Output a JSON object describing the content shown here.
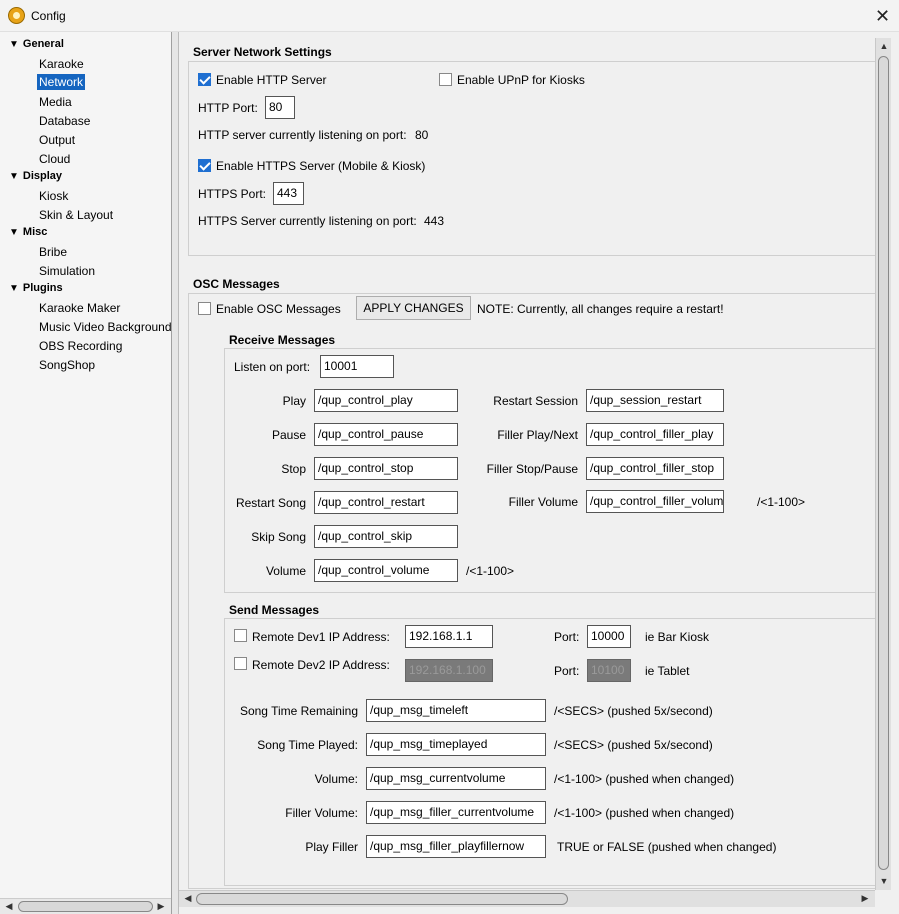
{
  "window": {
    "title": "Config",
    "close": "✕"
  },
  "sidebar": {
    "groups": [
      {
        "label": "General",
        "items": [
          "Karaoke",
          "Network",
          "Media",
          "Database",
          "Output",
          "Cloud"
        ]
      },
      {
        "label": "Display",
        "items": [
          "Kiosk",
          "Skin & Layout"
        ]
      },
      {
        "label": "Misc",
        "items": [
          "Bribe",
          "Simulation"
        ]
      },
      {
        "label": "Plugins",
        "items": [
          "Karaoke Maker",
          "Music Video Background",
          "OBS Recording",
          "SongShop"
        ]
      }
    ],
    "selected": "Network"
  },
  "server": {
    "title": "Server Network Settings",
    "http_enable": "Enable HTTP Server",
    "http_checked": true,
    "upnp_enable": "Enable UPnP for Kiosks",
    "upnp_checked": false,
    "http_port_label": "HTTP Port:",
    "http_port": "80",
    "http_status_label": "HTTP server currently listening on port:",
    "http_status_port": "80",
    "https_enable": "Enable HTTPS Server (Mobile & Kiosk)",
    "https_checked": true,
    "https_port_label": "HTTPS Port:",
    "https_port": "443",
    "https_status_label": "HTTPS Server currently listening on port:",
    "https_status_port": "443"
  },
  "osc": {
    "title": "OSC Messages",
    "enable": "Enable OSC Messages",
    "enabled": false,
    "apply": "APPLY CHANGES",
    "note": "NOTE: Currently, all changes require a restart!",
    "receive": {
      "title": "Receive Messages",
      "listen_label": "Listen on port:",
      "listen_port": "10001",
      "play_label": "Play",
      "play": "/qup_control_play",
      "pause_label": "Pause",
      "pause": "/qup_control_pause",
      "stop_label": "Stop",
      "stop": "/qup_control_stop",
      "restart_label": "Restart Song",
      "restart": "/qup_control_restart",
      "skip_label": "Skip Song",
      "skip": "/qup_control_skip",
      "volume_label": "Volume",
      "volume": "/qup_control_volume",
      "volume_hint": "/<1-100>",
      "session_label": "Restart Session",
      "session": "/qup_session_restart",
      "fplay_label": "Filler Play/Next",
      "fplay": "/qup_control_filler_play",
      "fstop_label": "Filler Stop/Pause",
      "fstop": "/qup_control_filler_stop",
      "fvol_label": "Filler Volume",
      "fvol": "/qup_control_filler_volume",
      "fvol_hint": "/<1-100>"
    },
    "send": {
      "title": "Send Messages",
      "dev1_label": "Remote Dev1 IP Address:",
      "dev1_ip": "192.168.1.1",
      "dev1_port": "10000",
      "dev1_note": "ie Bar Kiosk",
      "dev2_label": "Remote Dev2 IP Address:",
      "dev2_ip": "192.168.1.100",
      "dev2_port": "10100",
      "dev2_note": "ie Tablet",
      "port_label": "Port:",
      "remaining_label": "Song Time Remaining",
      "remaining": "/qup_msg_timeleft",
      "remaining_hint": "/<SECS>  (pushed 5x/second)",
      "played_label": "Song Time Played:",
      "played": "/qup_msg_timeplayed",
      "played_hint": "/<SECS>  (pushed 5x/second)",
      "vol_label": "Volume:",
      "vol": "/qup_msg_currentvolume",
      "vol_hint": "/<1-100>  (pushed when changed)",
      "fvol_label": "Filler Volume:",
      "fvol": "/qup_msg_filler_currentvolume",
      "fvol_hint": "/<1-100>  (pushed when changed)",
      "pfill_label": "Play Filler",
      "pfill": "/qup_msg_filler_playfillernow",
      "pfill_hint": "TRUE or FALSE  (pushed when changed)"
    }
  }
}
